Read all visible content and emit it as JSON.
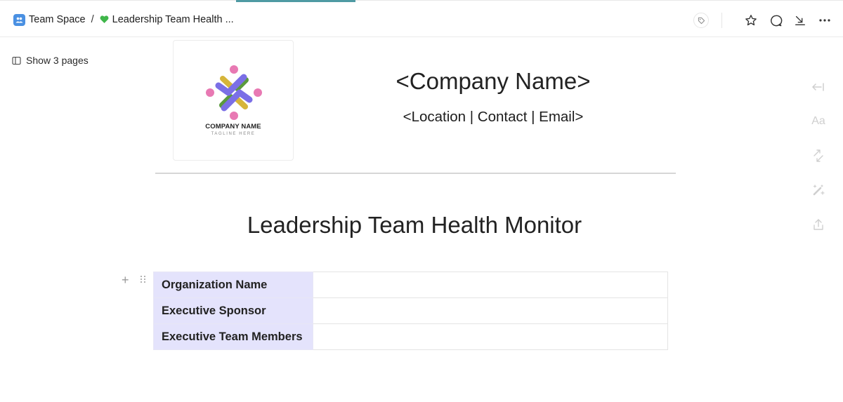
{
  "topbar": {
    "breadcrumb": [
      {
        "label": "Team Space",
        "icon": "team-space-icon"
      },
      {
        "label": "Leadership Team Health ...",
        "icon": "green-heart-icon"
      }
    ],
    "separator": "/",
    "actions": [
      "tag-icon",
      "star-icon",
      "comment-icon",
      "download-icon",
      "more-icon"
    ]
  },
  "sidebar_toggle": {
    "label": "Show 3 pages",
    "icon": "sidebar-panel-icon"
  },
  "header": {
    "logo": {
      "name": "COMPANY NAME",
      "tagline": "TAGLINE HERE"
    },
    "company_name": "<Company Name>",
    "company_info": "<Location | Contact | Email>"
  },
  "document": {
    "title": "Leadership Team Health Monitor",
    "info_table": [
      {
        "label": "Organization Name",
        "value": ""
      },
      {
        "label": "Executive Sponsor",
        "value": ""
      },
      {
        "label": "Executive Team Members",
        "value": ""
      }
    ]
  },
  "right_rail": {
    "icons": [
      "collapse-left-icon",
      "text-format-icon",
      "swap-icon",
      "magic-wand-icon",
      "share-upload-icon"
    ],
    "text_icon_label": "Aa"
  },
  "colors": {
    "accent": "#4f9aa3",
    "table_label_bg": "#e4e3fc",
    "logo_purple": "#7b6fe6",
    "logo_pink": "#e879b3",
    "logo_green": "#5a9a3c",
    "logo_yellow": "#d6b53a"
  }
}
